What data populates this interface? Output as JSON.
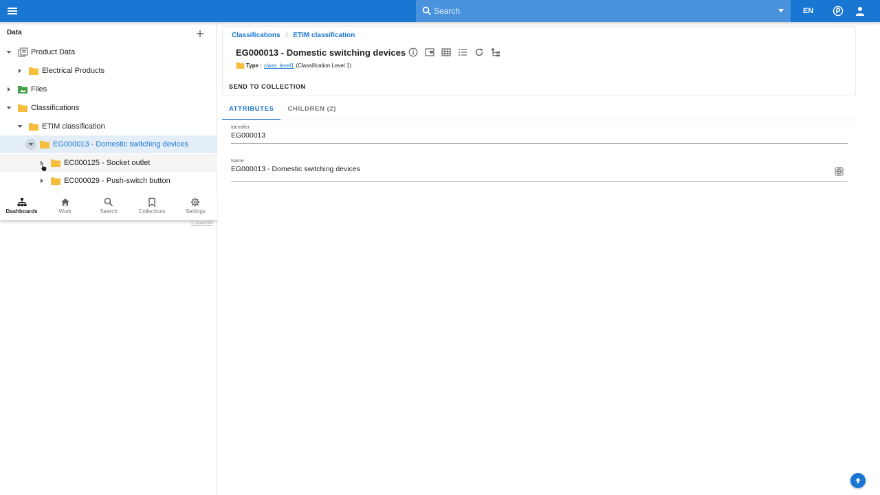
{
  "topbar": {
    "search_placeholder": "Search",
    "language": "EN"
  },
  "left_panel": {
    "header": "Data",
    "tree": [
      {
        "label": "Product Data",
        "expanded": true,
        "icon": "product-data-icon"
      },
      {
        "label": "Electrical Products",
        "expanded": false,
        "icon": "folder-icon"
      },
      {
        "label": "Files",
        "expanded": false,
        "icon": "image-folder-icon"
      },
      {
        "label": "Classifications",
        "expanded": true,
        "icon": "folder-icon"
      },
      {
        "label": "ETIM classification",
        "expanded": true,
        "icon": "folder-icon"
      },
      {
        "label": "EG000013 - Domestic switching devices",
        "expanded": true,
        "selected": true,
        "icon": "folder-icon"
      },
      {
        "label": "EC000125 - Socket outlet",
        "expanded": false,
        "icon": "folder-icon"
      },
      {
        "label": "EC000029 - Push-switch button",
        "expanded": false,
        "icon": "folder-icon"
      }
    ],
    "bottom_nav": [
      {
        "label": "Dashboards",
        "icon": "dashboards-icon",
        "active": true
      },
      {
        "label": "Work",
        "icon": "home-icon",
        "active": false
      },
      {
        "label": "Search",
        "icon": "search-icon",
        "active": false
      },
      {
        "label": "Collections",
        "icon": "bookmark-icon",
        "active": false
      },
      {
        "label": "Settings",
        "icon": "gear-icon",
        "active": false
      }
    ],
    "copyright": "© OpenPIM"
  },
  "main": {
    "breadcrumb": [
      "Classifications",
      "ETIM classification"
    ],
    "title": "EG000013 - Domestic switching devices",
    "type_label": "Type :",
    "type_link": "class_level1",
    "type_desc": "(Classification Level 1)",
    "send_button": "SEND TO COLLECTION",
    "tabs": [
      {
        "label": "ATTRIBUTES",
        "active": true
      },
      {
        "label": "CHILDREN (2)",
        "active": false
      }
    ],
    "fields": [
      {
        "label": "Identifier",
        "value": "EG000013"
      },
      {
        "label": "Name",
        "value": "EG000013 - Domestic switching devices"
      }
    ]
  },
  "colors": {
    "primary": "#1976d2",
    "folder": "#f6be3c",
    "files_folder": "#43a047",
    "selected_bg": "#e3eef9"
  }
}
